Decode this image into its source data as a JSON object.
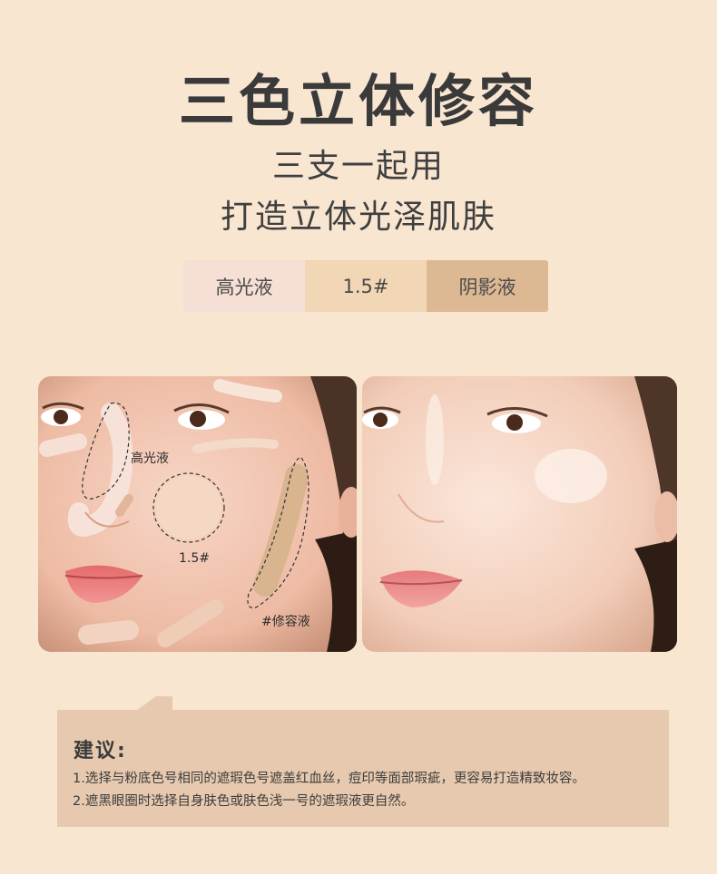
{
  "heading": {
    "title": "三色立体修容",
    "subtitle_line1": "三支一起用",
    "subtitle_line2": "打造立体光泽肌肤"
  },
  "shades": [
    {
      "label": "高光液",
      "color": "#f6dfd4"
    },
    {
      "label": "1.5#",
      "color": "#f2d7b6"
    },
    {
      "label": "阴影液",
      "color": "#dcb893"
    }
  ],
  "before_photo": {
    "labels": {
      "highlight": "高光液",
      "shade_15": "1.5#",
      "contour": "#修容液"
    }
  },
  "tips": {
    "title": "建议:",
    "line1": "1.选择与粉底色号相同的遮瑕色号遮盖红血丝，痘印等面部瑕疵，更容易打造精致妆容。",
    "line2": "2.遮黑眼圈时选择自身肤色或肤色浅一号的遮瑕液更自然。"
  },
  "colors": {
    "background": "#f8e6d1",
    "note_box": "#e6c9ae"
  }
}
